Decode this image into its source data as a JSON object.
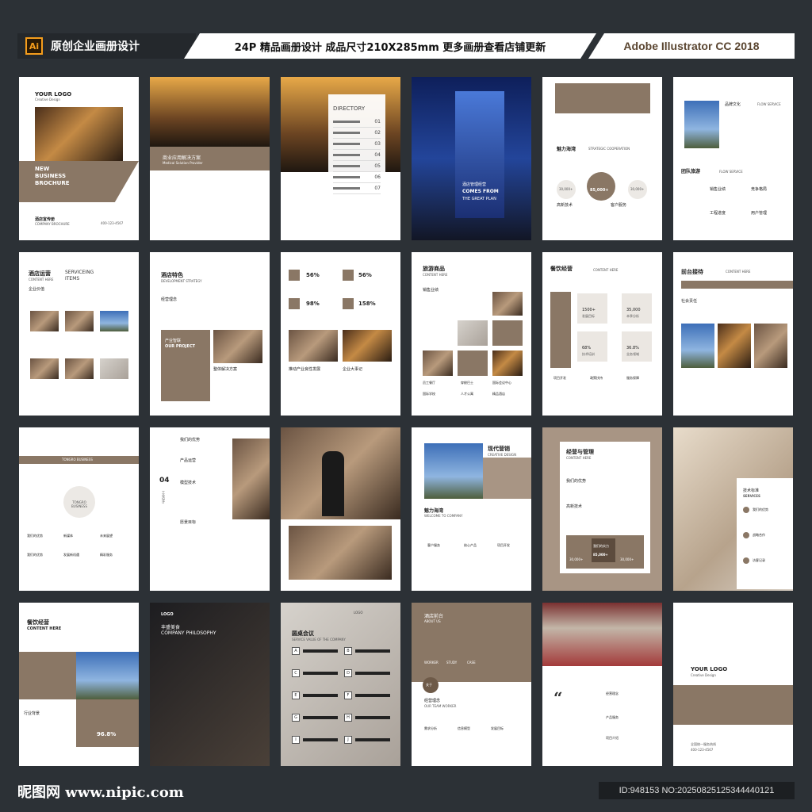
{
  "header": {
    "ai_badge": "Ai",
    "left_title": "原创企业画册设计",
    "middle_title": "24P 精品画册设计 成品尺寸210X285mm 更多画册查看店铺更新",
    "right_title": "Adobe Illustrator CC 2018"
  },
  "pages": {
    "p1": {
      "logo": "YOUR LOGO",
      "logo_sub": "Creative Design",
      "title1": "NEW",
      "title2": "BUSINESS",
      "title3": "BROCHURE",
      "footer_cn": "酒店宣传册",
      "footer_en": "COMPANY BROCHURE",
      "phone": "400-123-4567"
    },
    "p2": {
      "title_cn": "商业应用解决方案",
      "title_en": "Medical Solution Provider"
    },
    "p3": {
      "title": "DIRECTORY",
      "items": [
        "01",
        "02",
        "03",
        "04",
        "05",
        "06",
        "07"
      ]
    },
    "p4": {
      "cn": "酒店管理经营",
      "line1": "COMES FROM",
      "line2": "THE GREAT PLAN"
    },
    "p5": {
      "title_cn": "魅力海湾",
      "title_en": "STRATEGIC COOPERATION",
      "center": "85,000+",
      "left": "30,000+",
      "right": "30,000+",
      "lbl1": "高新技术",
      "lbl2": "客户服务"
    },
    "p6": {
      "h1": "品牌文化",
      "h1e": "FLOW SERVICE",
      "h2": "团队旅游",
      "h2e": "FLOW SERVICE",
      "i1": "销售业绩",
      "i2": "竞争格局",
      "i3": "工程进度",
      "i4": "用户管理"
    },
    "p7": {
      "cn": "酒店运营",
      "en1": "SERVICEING",
      "en2": "ITEMS",
      "sub": "CONTENT HERE",
      "label": "企业价值"
    },
    "p8": {
      "cn": "酒店特色",
      "en": "DEVELOPMENT STRATEGY",
      "label": "经营理念",
      "box_cn": "产业智联",
      "box_en": "OUR PROJECT",
      "cap": "整体解决方案"
    },
    "p9": {
      "v1": "56%",
      "v2": "56%",
      "v3": "98%",
      "v4": "158%",
      "c1": "推动产业良性发展",
      "c2": "企业大事记"
    },
    "p10": {
      "cn": "旅游商品",
      "en": "CONTENT HERE",
      "label": "销售业绩",
      "a": "员工餐厅",
      "b": "穿梭巴士",
      "c": "国际会议中心",
      "d": "国际学校",
      "e": "人才公寓",
      "f": "精品酒店"
    },
    "p11": {
      "cn": "餐饮经营",
      "en": "CONTENT HERE",
      "v1": "1500+",
      "v2": "35,000",
      "v3": "68%",
      "v4": "36.8%",
      "l1": "发展目标",
      "l2": "本季分析",
      "l3": "技术培训",
      "l4": "业务领域",
      "b1": "项目开发",
      "b2": "政策扶持",
      "b3": "服务保障"
    },
    "p12": {
      "cn": "前台接待",
      "en": "CONTENT HERE",
      "label": "社会责任"
    },
    "p13": {
      "brand": "TONGRO BUSINESS",
      "center": "TONGRO BUSINESS",
      "l1": "我们的优势",
      "l2": "新媒体",
      "l3": "未来展望",
      "l4": "我们的优势",
      "l5": "发展新机遇",
      "l6": "精彩服务"
    },
    "p14": {
      "num": "04",
      "v": "工业设计",
      "h1": "我们的优势",
      "h2": "产品运营",
      "h3": "模型技术",
      "h4": "愿景目标"
    },
    "p15": {},
    "p16": {
      "cn": "现代营销",
      "en": "CREATIVE DESIGN",
      "t": "魅力海湾",
      "te": "WELCOME TO COMPANY",
      "l1": "客户服务",
      "l2": "核心产品",
      "l3": "项目开发"
    },
    "p17": {
      "cn": "经营与管理",
      "en": "CONTENT HERE",
      "h1": "我们的优势",
      "h2": "高新技术",
      "center": "我们的实力",
      "v": "85,000+",
      "l": "30,000+",
      "r": "30,000+"
    },
    "p18": {
      "cn": "技术标准",
      "en": "SERVICES",
      "i1": "我们的优势",
      "i2": "战略合作",
      "i3": "访客记录"
    },
    "p19": {
      "cn": "餐饮经营",
      "en": "CONTENT HERE",
      "label": "行业背景",
      "pct": "96.8%"
    },
    "p20": {
      "logo": "LOGO",
      "cn": "丰盛美食",
      "en": "COMPANY PHILOSOPHY"
    },
    "p21": {
      "logo": "LOGO",
      "cn": "圆桌会议",
      "en": "SERVICE VALUE OF THE COMPANY",
      "left": [
        "A",
        "C",
        "E",
        "G",
        "I"
      ],
      "right": [
        "B",
        "D",
        "F",
        "H",
        "J"
      ]
    },
    "p22": {
      "cn": "酒店前台",
      "en": "ABOUT US",
      "w1": "WORKER",
      "w2": "STUDY",
      "w3": "CASE",
      "badge": "关于",
      "t": "经营理念",
      "te": "OUR TEAM WORKER",
      "c1": "需求分析",
      "c2": "信息模型",
      "c3": "发展目标"
    },
    "p23": {
      "quote": "“",
      "i1": "经营理念",
      "i2": "产品服务",
      "i3": "项目介绍"
    },
    "p24": {
      "logo": "YOUR LOGO",
      "sub": "Creative Design",
      "foot1": "全国统一服务热线",
      "foot2": "400-123-4567"
    }
  },
  "footer": {
    "site": "昵图网 www.nipic.com",
    "id": "ID:948153 NO:20250825125344440121"
  }
}
